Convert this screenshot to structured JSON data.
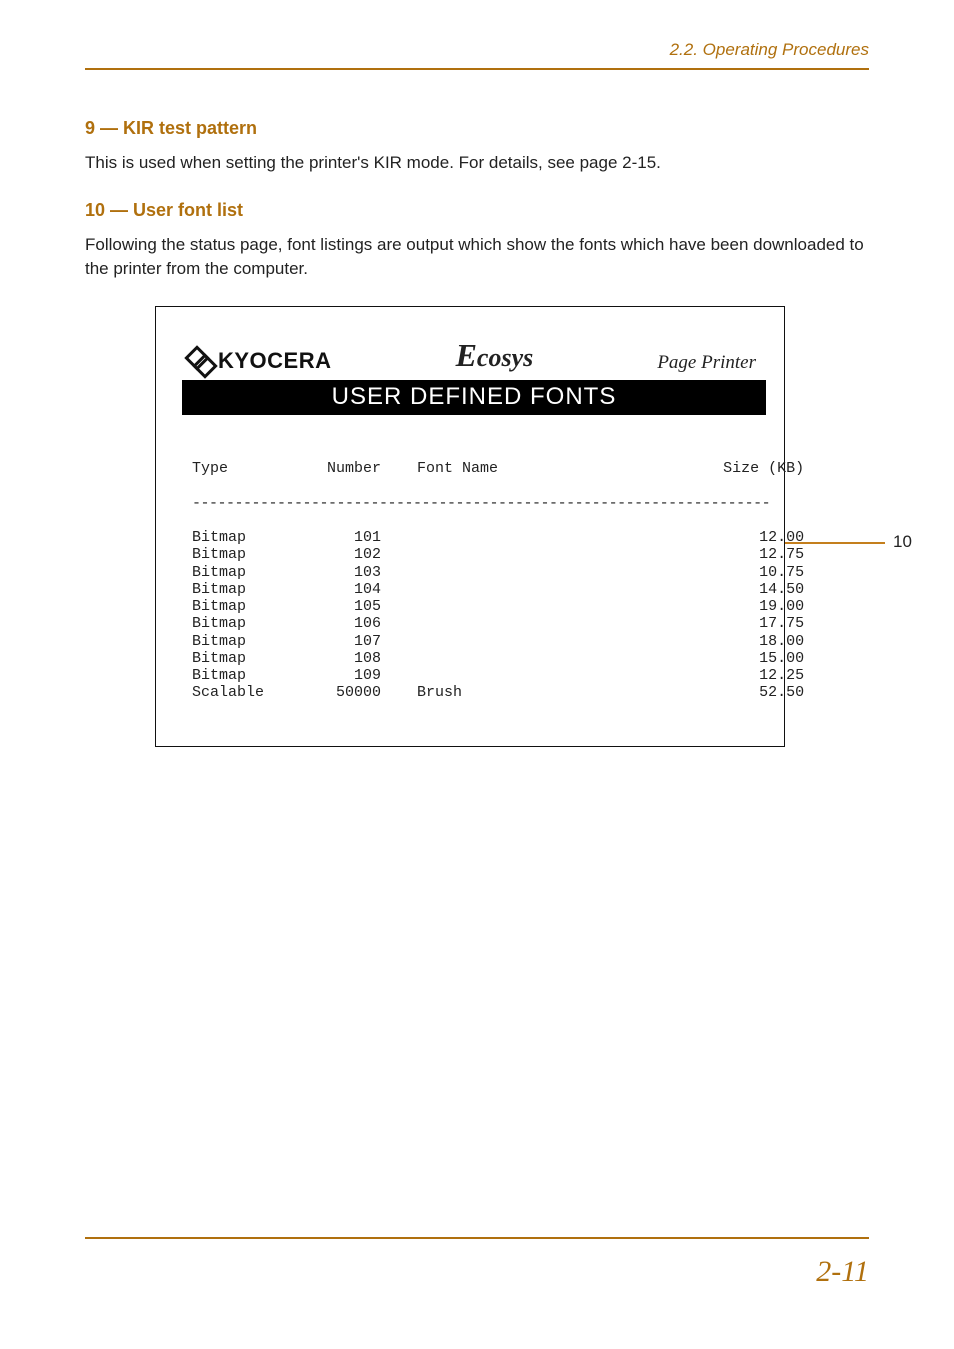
{
  "header": {
    "section_ref": "2.2. Operating Procedures"
  },
  "section9": {
    "heading": "9 — KIR test pattern",
    "body": "This is used when setting the printer's KIR mode. For details, see page 2-15."
  },
  "section10": {
    "heading": "10 — User font list",
    "body": "Following the status page, font listings are output which show the fonts which have been downloaded to the printer from the computer."
  },
  "sample": {
    "brand": "KYOCERA",
    "ecosys": "cosys",
    "pageprinter": "Page Printer",
    "bar_title": "USER DEFINED FONTS",
    "columns": {
      "c1": "Type",
      "c2": "Number",
      "c3": "Font Name",
      "c4": "Size (KB)"
    },
    "dashline": "--------------------------------------------------------------------",
    "rows": [
      {
        "type": "Bitmap",
        "number": "101",
        "name": "",
        "size": "12.00"
      },
      {
        "type": "Bitmap",
        "number": "102",
        "name": "",
        "size": "12.75"
      },
      {
        "type": "Bitmap",
        "number": "103",
        "name": "",
        "size": "10.75"
      },
      {
        "type": "Bitmap",
        "number": "104",
        "name": "",
        "size": "14.50"
      },
      {
        "type": "Bitmap",
        "number": "105",
        "name": "",
        "size": "19.00"
      },
      {
        "type": "Bitmap",
        "number": "106",
        "name": "",
        "size": "17.75"
      },
      {
        "type": "Bitmap",
        "number": "107",
        "name": "",
        "size": "18.00"
      },
      {
        "type": "Bitmap",
        "number": "108",
        "name": "",
        "size": "15.00"
      },
      {
        "type": "Bitmap",
        "number": "109",
        "name": "",
        "size": "12.25"
      },
      {
        "type": "Scalable",
        "number": "50000",
        "name": "Brush",
        "size": "52.50"
      }
    ]
  },
  "callout": {
    "label": "10"
  },
  "footer": {
    "page": "2-11"
  }
}
